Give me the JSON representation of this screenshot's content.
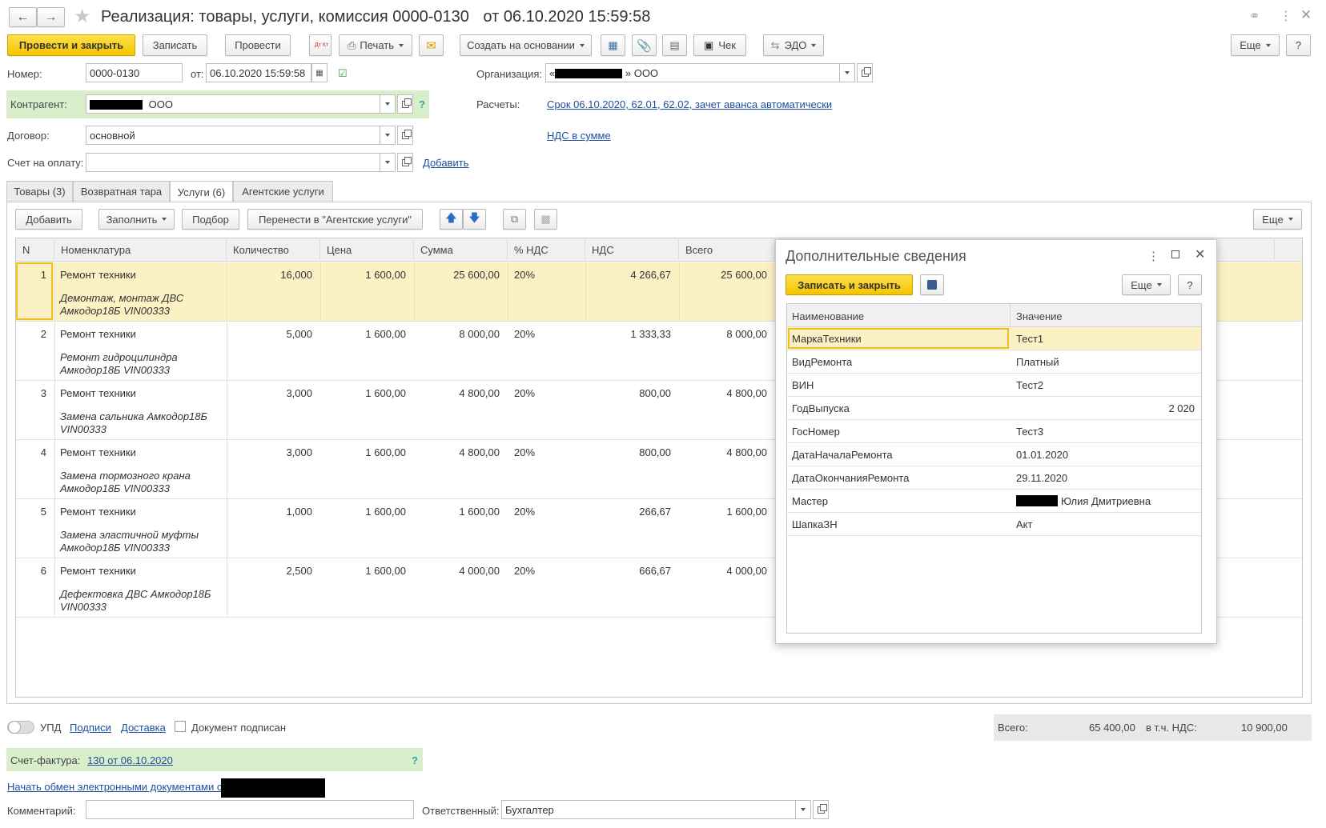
{
  "window": {
    "title": "Реализация: товары, услуги, комиссия 0000-0130",
    "title_date": "от 06.10.2020 15:59:58"
  },
  "toolbar": {
    "post_close": "Провести и закрыть",
    "save": "Записать",
    "post": "Провести",
    "dtkt": "Дт Кт",
    "print": "Печать",
    "create_based": "Создать на основании",
    "check": "Чек",
    "edo": "ЭДО",
    "more": "Еще",
    "help": "?"
  },
  "header": {
    "number_label": "Номер:",
    "number_value": "0000-0130",
    "from_label": "от:",
    "date_value": "06.10.2020 15:59:58",
    "org_label": "Организация:",
    "org_value_suffix": "» ООО",
    "org_value_prefix": "«",
    "counterparty_label": "Контрагент:",
    "counterparty_value": "ООО",
    "contract_label": "Договор:",
    "contract_value": "основной",
    "payment_invoice_label": "Счет на оплату:",
    "add_link": "Добавить",
    "settlements_label": "Расчеты:",
    "settlements_link": "Срок 06.10.2020, 62.01, 62.02, зачет аванса автоматически",
    "vat_link": "НДС в сумме",
    "help": "?"
  },
  "tabs": [
    {
      "label": "Товары (3)"
    },
    {
      "label": "Возвратная тара"
    },
    {
      "label": "Услуги (6)"
    },
    {
      "label": "Агентские услуги"
    }
  ],
  "table_toolbar": {
    "add": "Добавить",
    "fill": "Заполнить",
    "select": "Подбор",
    "move_agent": "Перенести в \"Агентские услуги\"",
    "more": "Еще"
  },
  "table": {
    "columns": [
      "N",
      "Номенклатура",
      "Количество",
      "Цена",
      "Сумма",
      "% НДС",
      "НДС",
      "Всего"
    ],
    "rows": [
      {
        "n": "1",
        "name": "Ремонт техники",
        "desc1": "Демонтаж, монтаж ДВС",
        "desc2": "Амкодор18Б VIN00333",
        "qty": "16,000",
        "price": "1 600,00",
        "sum": "25 600,00",
        "vat_rate": "20%",
        "vat": "4 266,67",
        "total": "25 600,00"
      },
      {
        "n": "2",
        "name": "Ремонт техники",
        "desc1": "Ремонт гидроцилиндра",
        "desc2": "Амкодор18Б VIN00333",
        "qty": "5,000",
        "price": "1 600,00",
        "sum": "8 000,00",
        "vat_rate": "20%",
        "vat": "1 333,33",
        "total": "8 000,00"
      },
      {
        "n": "3",
        "name": "Ремонт техники",
        "desc1": "Замена сальника Амкодор18Б",
        "desc2": "VIN00333",
        "qty": "3,000",
        "price": "1 600,00",
        "sum": "4 800,00",
        "vat_rate": "20%",
        "vat": "800,00",
        "total": "4 800,00"
      },
      {
        "n": "4",
        "name": "Ремонт техники",
        "desc1": "Замена тормозного крана",
        "desc2": "Амкодор18Б VIN00333",
        "qty": "3,000",
        "price": "1 600,00",
        "sum": "4 800,00",
        "vat_rate": "20%",
        "vat": "800,00",
        "total": "4 800,00"
      },
      {
        "n": "5",
        "name": "Ремонт техники",
        "desc1": "Замена эластичной муфты",
        "desc2": "Амкодор18Б VIN00333",
        "qty": "1,000",
        "price": "1 600,00",
        "sum": "1 600,00",
        "vat_rate": "20%",
        "vat": "266,67",
        "total": "1 600,00"
      },
      {
        "n": "6",
        "name": "Ремонт техники",
        "desc1": "Дефектовка ДВС Амкодор18Б",
        "desc2": "VIN00333",
        "qty": "2,500",
        "price": "1 600,00",
        "sum": "4 000,00",
        "vat_rate": "20%",
        "vat": "666,67",
        "total": "4 000,00"
      }
    ]
  },
  "dialog": {
    "title": "Дополнительные сведения",
    "save_close": "Записать и закрыть",
    "more": "Еще",
    "help": "?",
    "col_name": "Наименование",
    "col_value": "Значение",
    "rows": [
      {
        "name": "МаркаТехники",
        "value": "Тест1"
      },
      {
        "name": "ВидРемонта",
        "value": "Платный"
      },
      {
        "name": "ВИН",
        "value": "Тест2"
      },
      {
        "name": "ГодВыпуска",
        "value": "2 020"
      },
      {
        "name": "ГосНомер",
        "value": "Тест3"
      },
      {
        "name": "ДатаНачалаРемонта",
        "value": "01.01.2020"
      },
      {
        "name": "ДатаОкончанияРемонта",
        "value": "29.11.2020"
      },
      {
        "name": "Мастер",
        "value": "Юлия Дмитриевна"
      },
      {
        "name": "ШапкаЗН",
        "value": "Акт"
      }
    ]
  },
  "footer": {
    "upd": "УПД",
    "signatures": "Подписи",
    "delivery": "Доставка",
    "doc_signed": "Документ подписан",
    "total_label": "Всего:",
    "total_value": "65 400,00",
    "vat_label": "в т.ч. НДС:",
    "vat_value": "10 900,00",
    "invoice_label": "Счет-фактура:",
    "invoice_link": "130 от 06.10.2020",
    "invoice_help": "?",
    "edo_link": "Начать обмен электронными документами с",
    "comment_label": "Комментарий:",
    "responsible_label": "Ответственный:",
    "responsible_value": "Бухгалтер"
  }
}
